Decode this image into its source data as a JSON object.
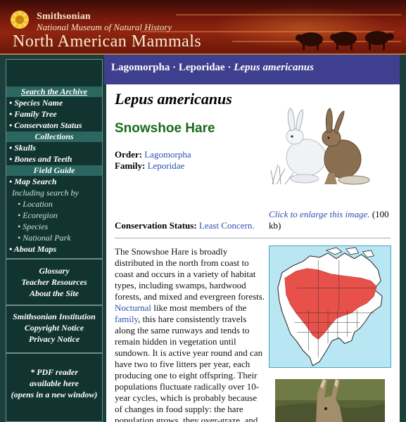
{
  "header": {
    "institution": "Smithsonian",
    "museum": "National Museum of Natural History",
    "site_title": "North American Mammals"
  },
  "breadcrumb": {
    "order": "Lagomorpha",
    "separator": "·",
    "family": "Leporidae",
    "species": "Lepus americanus"
  },
  "sidebar": {
    "search_archive": "Search the Archive",
    "species_name": "• Species Name",
    "family_tree": "• Family Tree",
    "conservation_status": "• Conservaton Status",
    "collections": "Collections",
    "skulls": "• Skulls",
    "bones_teeth": "• Bones and Teeth",
    "field_guide": "Field Guide",
    "map_search": "• Map Search",
    "including": "Including search by",
    "location": "• Location",
    "ecoregion": "• Ecoregion",
    "species": "• Species",
    "national_park": "• National Park",
    "about_maps": "• About Maps",
    "glossary": "Glossary",
    "teacher_resources": "Teacher Resources",
    "about_site": "About the Site",
    "smithsonian_institution": "Smithsonian Institution",
    "copyright": "Copyright Notice",
    "privacy": "Privacy Notice",
    "pdf_reader": "* PDF reader",
    "available_here": "available here",
    "new_window": "(opens in a new window)"
  },
  "species_page": {
    "scientific_name": "Lepus americanus",
    "common_name": "Snowshoe Hare",
    "order_label": "Order:",
    "order_value": "Lagomorpha",
    "family_label": "Family:",
    "family_value": "Leporidae",
    "enlarge_link": "Click to enlarge this image.",
    "enlarge_size": "(100 kb)",
    "conservation_label": "Conservation Status:",
    "conservation_value": "Least Concern.",
    "desc_1": "The Snowshoe Hare is broadly distributed in the north from coast to coast and occurs in a variety of habitat types, including swamps, hardwood forests, and mixed and evergreen forests.",
    "desc_nocturnal": "Nocturnal",
    "desc_2": "like most members of the",
    "desc_family": "family",
    "desc_3": ", this hare consistently travels along the same runways and tends to remain hidden in vegetation until sundown. It is active year round and can have two to five litters per year, each producing one to eight offspring. Their populations fluctuate radically over 10-year cycles, which is probably because of changes in food supply: the hare population grows, they over-graze, and starvation follows. True to"
  },
  "colors": {
    "header_red": "#8f2410",
    "breadcrumb_blue": "#3f3f8f",
    "sidebar_dark": "#123430",
    "sidebar_section": "#2b6661",
    "link_blue": "#2d4fb0",
    "common_name_green": "#1a6b1a",
    "range_red": "#e8504a"
  }
}
